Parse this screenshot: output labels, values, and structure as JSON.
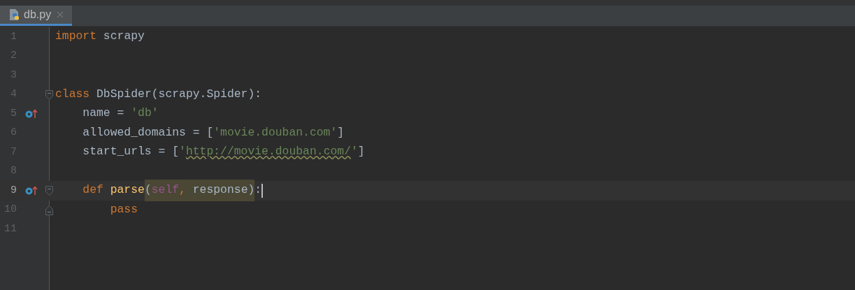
{
  "tabs": [
    {
      "label": "db.py",
      "selected": true,
      "closable": true
    }
  ],
  "editor": {
    "lines": [
      {
        "number": "1",
        "current": false,
        "override_mark": false,
        "fold_start": false,
        "fold_end": false,
        "caret": false,
        "tokens": [
          {
            "kind": "keyword",
            "text": "import"
          },
          {
            "kind": "plain",
            "text": " scrapy"
          }
        ]
      },
      {
        "number": "2",
        "current": false,
        "override_mark": false,
        "fold_start": false,
        "fold_end": false,
        "caret": false
      },
      {
        "number": "3",
        "current": false,
        "override_mark": false,
        "fold_start": false,
        "fold_end": false,
        "caret": false
      },
      {
        "number": "4",
        "current": false,
        "override_mark": false,
        "fold_start": true,
        "fold_end": false,
        "caret": false,
        "tokens": [
          {
            "kind": "keyword",
            "text": "class"
          },
          {
            "kind": "plain",
            "text": " DbSpider(scrapy.Spider):"
          }
        ]
      },
      {
        "number": "5",
        "current": false,
        "override_mark": true,
        "fold_start": false,
        "fold_end": false,
        "caret": false,
        "tokens": [
          {
            "kind": "plain",
            "text": "    name = "
          },
          {
            "kind": "string",
            "text": "'db'"
          }
        ]
      },
      {
        "number": "6",
        "current": false,
        "override_mark": false,
        "fold_start": false,
        "fold_end": false,
        "caret": false,
        "tokens": [
          {
            "kind": "plain",
            "text": "    allowed_domains = ["
          },
          {
            "kind": "string",
            "text": "'movie.douban.com'"
          },
          {
            "kind": "plain",
            "text": "]"
          }
        ]
      },
      {
        "number": "7",
        "current": false,
        "override_mark": false,
        "fold_start": false,
        "fold_end": false,
        "caret": false,
        "tokens": [
          {
            "kind": "plain",
            "text": "    start_urls = ["
          },
          {
            "kind": "string",
            "text": "'"
          },
          {
            "kind": "url",
            "text": "http://movie.douban.com/"
          },
          {
            "kind": "string",
            "text": "'"
          },
          {
            "kind": "plain",
            "text": "]"
          }
        ]
      },
      {
        "number": "8",
        "current": false,
        "override_mark": false,
        "fold_start": false,
        "fold_end": false,
        "caret": false
      },
      {
        "number": "9",
        "current": true,
        "override_mark": true,
        "fold_start": true,
        "fold_end": false,
        "caret": true,
        "tokens": [
          {
            "kind": "keyword",
            "text": "    def",
            "highlighted": false
          },
          {
            "kind": "function",
            "text": " parse",
            "highlighted": false
          },
          {
            "kind": "plain",
            "text": "(",
            "highlighted": true
          },
          {
            "kind": "self",
            "text": "self",
            "highlighted": true
          },
          {
            "kind": "keyword",
            "text": ",",
            "highlighted": true
          },
          {
            "kind": "plain",
            "text": " response)",
            "highlighted": true
          },
          {
            "kind": "plain",
            "text": ":",
            "highlighted": false
          }
        ]
      },
      {
        "number": "10",
        "current": false,
        "override_mark": false,
        "fold_start": false,
        "fold_end": true,
        "caret": false,
        "tokens": [
          {
            "kind": "keyword",
            "text": "        pass"
          }
        ]
      },
      {
        "number": "11",
        "current": false,
        "override_mark": false,
        "fold_start": false,
        "fold_end": false,
        "caret": false
      }
    ]
  }
}
